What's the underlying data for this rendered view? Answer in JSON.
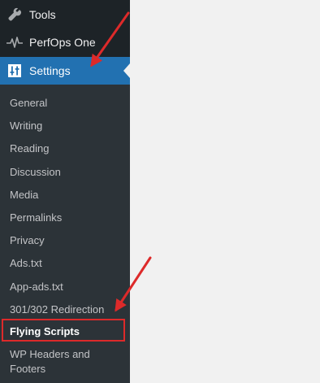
{
  "menu": {
    "tools": {
      "label": "Tools",
      "icon": "wrench-icon"
    },
    "perfops": {
      "label": "PerfOps One",
      "icon": "pulse-icon"
    },
    "settings": {
      "label": "Settings",
      "icon": "settings-sliders-icon"
    }
  },
  "submenu": [
    {
      "label": "General"
    },
    {
      "label": "Writing"
    },
    {
      "label": "Reading"
    },
    {
      "label": "Discussion"
    },
    {
      "label": "Media"
    },
    {
      "label": "Permalinks"
    },
    {
      "label": "Privacy"
    },
    {
      "label": "Ads.txt"
    },
    {
      "label": "App-ads.txt"
    },
    {
      "label": "301/302 Redirection"
    },
    {
      "label": "Flying Scripts"
    },
    {
      "label": "WP Headers and Footers"
    }
  ],
  "colors": {
    "sidebar_bg": "#1d2327",
    "submenu_bg": "#2c3338",
    "active_bg": "#2271b1",
    "annotation_red": "#dd2a2a",
    "content_bg": "#f1f1f1"
  }
}
